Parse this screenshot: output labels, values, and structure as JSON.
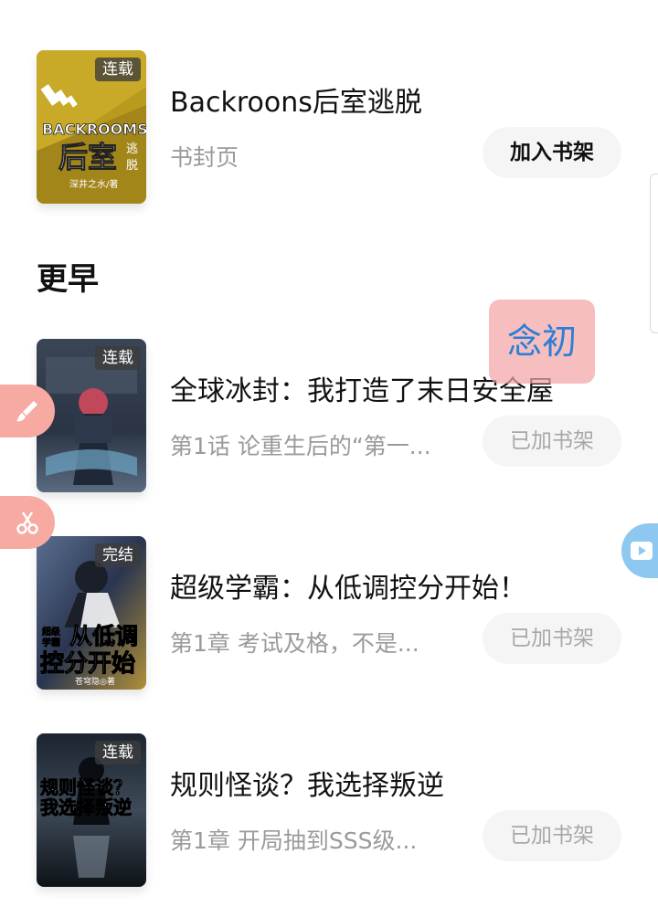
{
  "books_top": [
    {
      "badge": "连载",
      "title": "Backroons后室逃脱",
      "subtitle": "书封页",
      "button": "加入书架",
      "cover_text": {
        "line1": "BACKROOMS",
        "line2": "后室",
        "side": "逃脱",
        "author": "深井之水/著"
      }
    }
  ],
  "section_title": "更早",
  "books": [
    {
      "badge": "连载",
      "title": "全球冰封：我打造了末日安全屋",
      "subtitle": "第1话 论重生后的“第一...",
      "button": "已加书架"
    },
    {
      "badge": "完结",
      "title": "超级学霸：从低调控分开始！",
      "subtitle": "第1章 考试及格，不是...",
      "button": "已加书架",
      "cover_text": {
        "top": "超级",
        "top2": "学霸",
        "line1": "从低调",
        "line2": "控分开始",
        "author": "苍穹隐◎著"
      }
    },
    {
      "badge": "连载",
      "title": "规则怪谈？我选择叛逆",
      "subtitle": "第1章 开局抽到SSS级...",
      "button": "已加书架",
      "cover_text": {
        "line1": "规则怪谈？",
        "line2": "我选择叛逆"
      }
    }
  ],
  "floating_tag": "念初",
  "icons": [
    "brush-icon",
    "scissors-icon",
    "video-play-icon"
  ],
  "colors": {
    "accent_blue": "#2a7fd6",
    "tag_bg": "#f2a5a5",
    "side_icon_bg": "#f6aaa2",
    "video_bg": "#8ec7f0"
  }
}
